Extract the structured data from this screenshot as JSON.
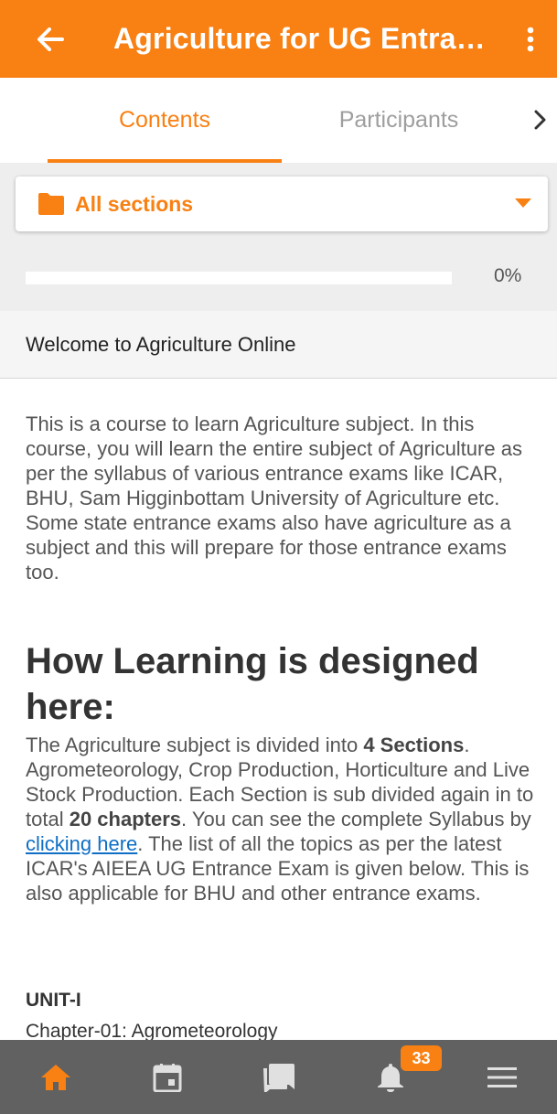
{
  "colors": {
    "accent": "#f98012",
    "bottom_bar": "#616161",
    "link": "#0f6fc5"
  },
  "header": {
    "title": "Agriculture for UG Entrance Exams",
    "back_icon": "arrow-left-icon",
    "menu_icon": "more-vert-icon"
  },
  "tabs": [
    {
      "label": "Contents",
      "active": true
    },
    {
      "label": "Participants",
      "active": false
    }
  ],
  "section_selector": {
    "icon": "folder-icon",
    "label": "All sections",
    "caret_icon": "caret-down-icon"
  },
  "progress": {
    "value": 0,
    "text": "0%"
  },
  "section_title": "Welcome to Agriculture Online",
  "content": {
    "intro": "This is a course to learn Agriculture subject. In this course, you will learn the entire subject of Agriculture as per the syllabus of various entrance exams like ICAR, BHU, Sam Higginbottam University of Agriculture etc. Some state entrance exams also have agriculture as a subject and this will prepare for those entrance exams too.",
    "heading": "How Learning is designed here:",
    "design_part1": "The Agriculture subject is divided into ",
    "design_bold1": "4 Sections",
    "design_part2": ". Agrometeorology, Crop Production, Horticulture and Live Stock Production. Each Section is sub divided again in to total ",
    "design_bold2": "20 chapters",
    "design_part3": ". You can see the complete Syllabus by ",
    "design_link": "clicking here",
    "design_part4": ". The list of all the topics as per the latest ICAR's AIEEA UG Entrance Exam is given below. This is also applicable for BHU and other entrance exams.",
    "unit_title": "UNIT-I",
    "chapter_1": "Chapter-01: Agrometeorology"
  },
  "bottom_nav": {
    "items": [
      {
        "icon": "home-icon",
        "active": true
      },
      {
        "icon": "calendar-icon",
        "active": false
      },
      {
        "icon": "messages-icon",
        "active": false
      },
      {
        "icon": "bell-icon",
        "active": false
      },
      {
        "icon": "hamburger-menu-icon",
        "active": false
      }
    ],
    "notification_count": "33"
  }
}
